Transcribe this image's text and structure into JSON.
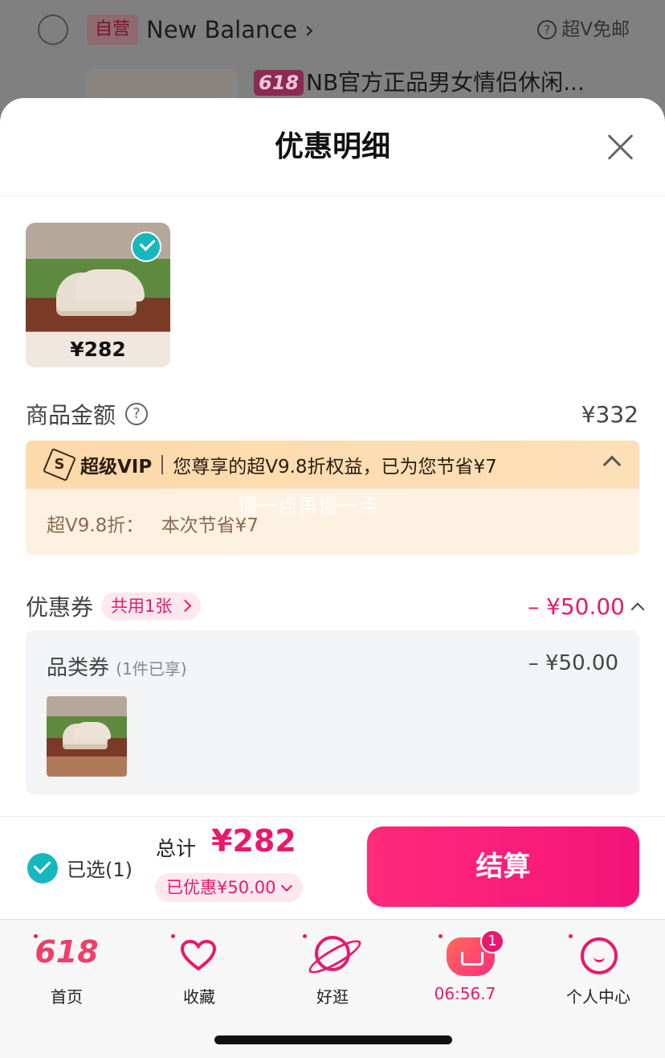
{
  "background": {
    "badge": "自营",
    "brand": "New Balance",
    "vip_shipping": "超V免邮",
    "promo_badge": "618",
    "product_title": "NB官方正品男女情侣休闲..."
  },
  "sheet": {
    "title": "优惠明细",
    "product": {
      "price": "¥282"
    },
    "amount": {
      "label": "商品金额",
      "value": "¥332"
    },
    "vip": {
      "tag": "超级VIP",
      "text": "您尊享的超V9.8折权益，已为您节省¥7",
      "detail_label": "超V9.8折：",
      "detail_value": "本次节省¥7"
    },
    "watermark": "慢一点再慢一点",
    "coupon": {
      "label": "优惠券",
      "pill": "共用1张",
      "amount": "– ¥50.00"
    },
    "category_coupon": {
      "title": "品类券",
      "note": "(1件已享)",
      "amount": "– ¥50.00"
    }
  },
  "checkout": {
    "selected": "已选(1)",
    "total_label": "总计",
    "total_value": "¥282",
    "saved": "已优惠¥50.00",
    "pay_button": "结算"
  },
  "tabbar": {
    "items": [
      {
        "label": "首页",
        "icon": "618-icon"
      },
      {
        "label": "收藏",
        "icon": "heart-icon"
      },
      {
        "label": "好逛",
        "icon": "planet-icon"
      },
      {
        "label": "06:56.7",
        "icon": "cart-icon",
        "badge": "1"
      },
      {
        "label": "个人中心",
        "icon": "face-icon"
      }
    ]
  },
  "colors": {
    "accent": "#e8196d",
    "check": "#17b8bd",
    "vip_bg": "#fdd9ab"
  }
}
